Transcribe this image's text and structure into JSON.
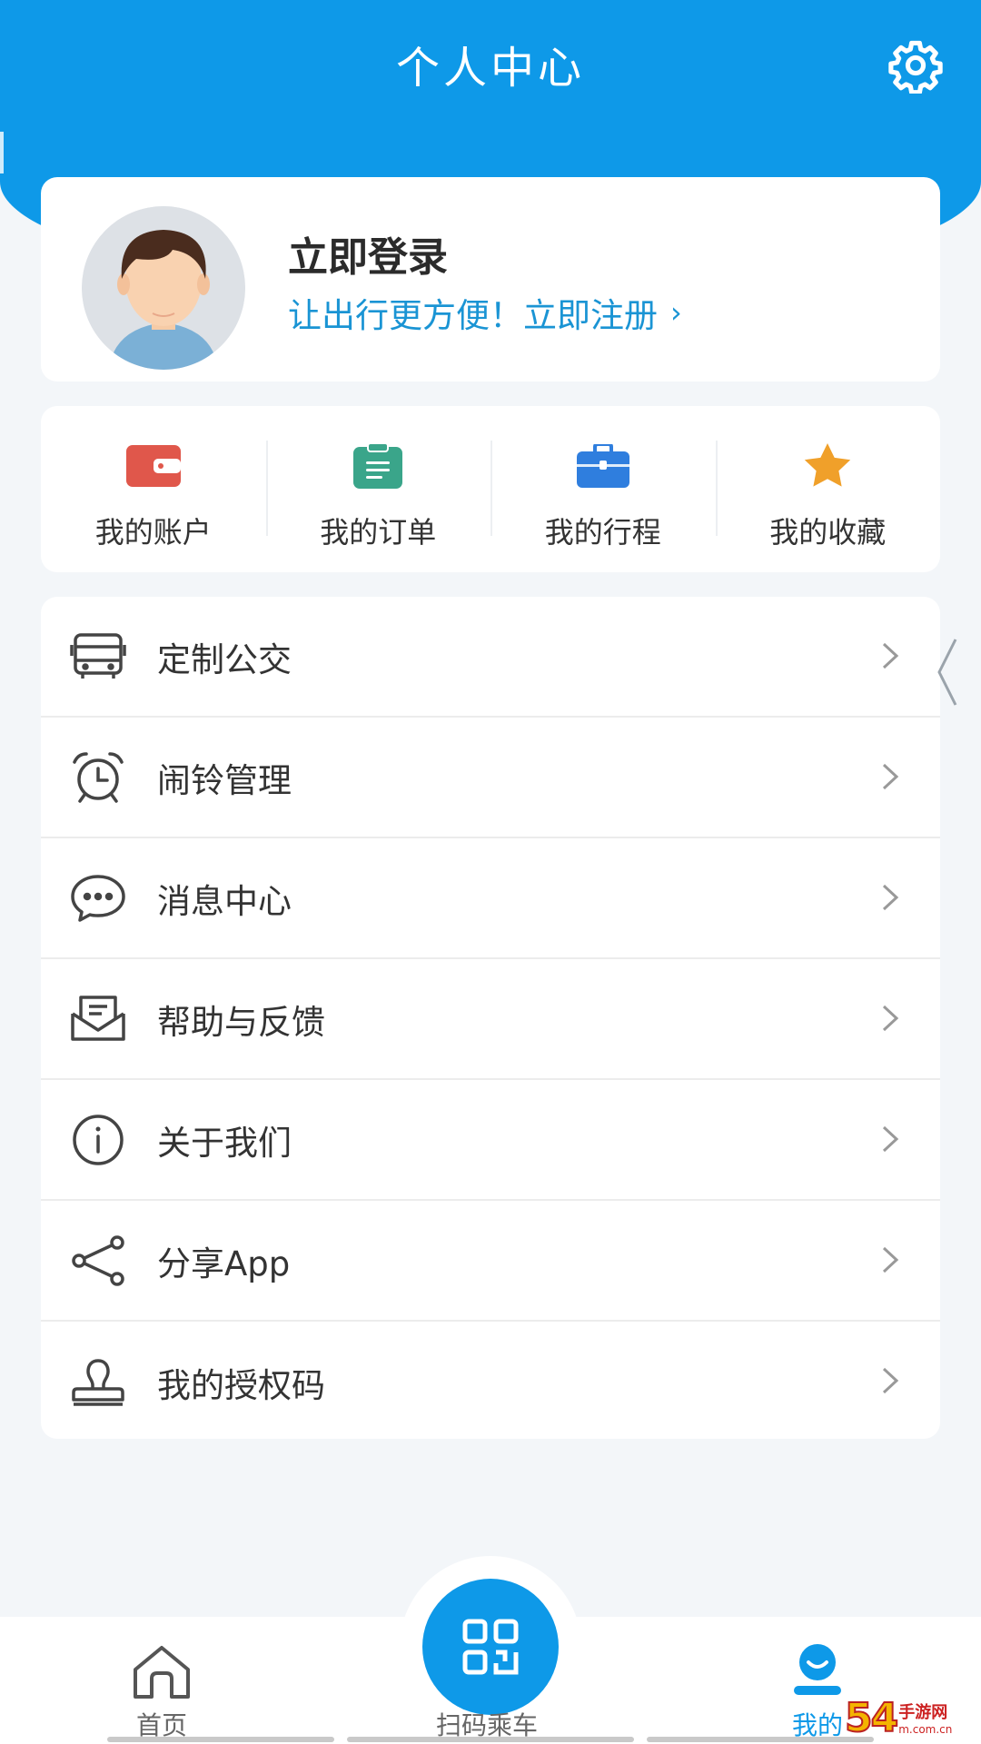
{
  "header": {
    "title": "个人中心",
    "settings_icon": "gear-icon"
  },
  "login": {
    "title": "立即登录",
    "subtitle": "让出行更方便！立即注册",
    "chevron": "›"
  },
  "quick_actions": [
    {
      "label": "我的账户",
      "icon": "wallet-icon",
      "color": "#e0574b"
    },
    {
      "label": "我的订单",
      "icon": "clipboard-icon",
      "color": "#3aa58a"
    },
    {
      "label": "我的行程",
      "icon": "briefcase-icon",
      "color": "#2f7ede"
    },
    {
      "label": "我的收藏",
      "icon": "star-icon",
      "color": "#f0a02a"
    }
  ],
  "menu": [
    {
      "label": "定制公交",
      "icon": "bus-icon"
    },
    {
      "label": "闹铃管理",
      "icon": "alarm-clock-icon"
    },
    {
      "label": "消息中心",
      "icon": "chat-bubble-icon"
    },
    {
      "label": "帮助与反馈",
      "icon": "mail-feedback-icon"
    },
    {
      "label": "关于我们",
      "icon": "info-icon"
    },
    {
      "label": "分享App",
      "icon": "share-icon"
    },
    {
      "label": "我的授权码",
      "icon": "stamp-icon"
    }
  ],
  "tabbar": {
    "home": "首页",
    "scan": "扫码乘车",
    "mine": "我的"
  },
  "watermark": {
    "num": "54",
    "top": "手游网",
    "bottom": "m.com.cn"
  },
  "colors": {
    "primary": "#0e99e8",
    "link": "#1a94d4"
  }
}
